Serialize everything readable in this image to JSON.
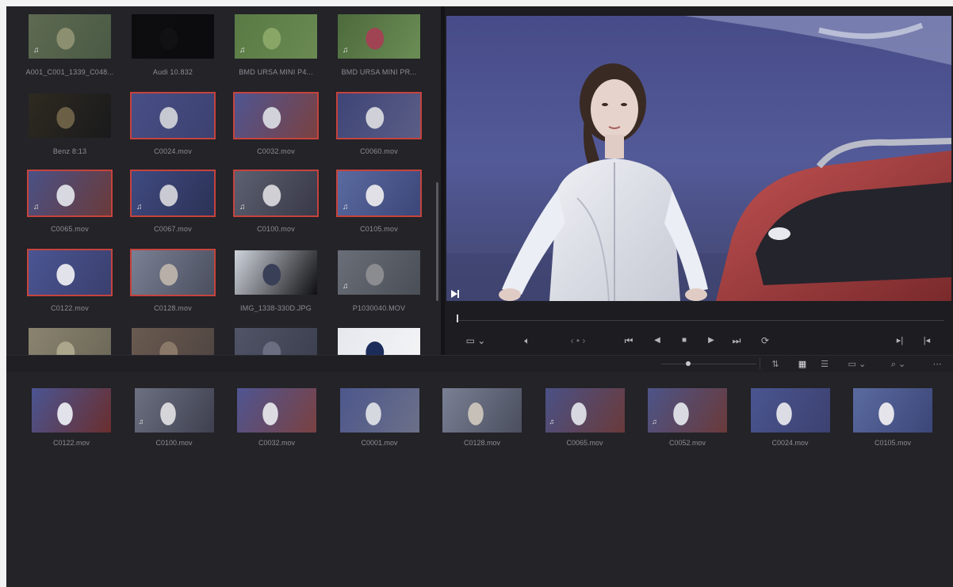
{
  "media_pool": {
    "clips": [
      {
        "label": "A001_C001_1339_C048...",
        "selected": false,
        "audio": true,
        "palette": [
          "#5e6a52",
          "#8c9070",
          "#4a5a44"
        ]
      },
      {
        "label": "Audi 10.832",
        "selected": false,
        "audio": false,
        "palette": [
          "#0d0d0f",
          "#111114",
          "#0c0c0e"
        ]
      },
      {
        "label": "BMD URSA MINI P4...",
        "selected": false,
        "audio": true,
        "palette": [
          "#5a7a45",
          "#89a667",
          "#6a8a52"
        ]
      },
      {
        "label": "BMD URSA MINI PR...",
        "selected": false,
        "audio": true,
        "palette": [
          "#4d6a3c",
          "#a04454",
          "#6b8d55"
        ]
      },
      {
        "label": "Benz 8:13",
        "selected": false,
        "audio": false,
        "palette": [
          "#2e2a20",
          "#6b6046",
          "#1a1a1c"
        ]
      },
      {
        "label": "C0024.mov",
        "selected": true,
        "audio": false,
        "palette": [
          "#484f86",
          "#c7c9d2",
          "#3c4170"
        ]
      },
      {
        "label": "C0032.mov",
        "selected": true,
        "audio": false,
        "palette": [
          "#4f5592",
          "#d2d3da",
          "#7a4141"
        ]
      },
      {
        "label": "C0060.mov",
        "selected": true,
        "audio": false,
        "palette": [
          "#3e4476",
          "#d0d1d8",
          "#5a5e86"
        ]
      },
      {
        "label": "C0065.mov",
        "selected": true,
        "audio": true,
        "palette": [
          "#4a5186",
          "#d8d9e0",
          "#6a3a3a"
        ]
      },
      {
        "label": "C0067.mov",
        "selected": true,
        "audio": true,
        "palette": [
          "#3f4a80",
          "#c9cad2",
          "#2c3256"
        ]
      },
      {
        "label": "C0100.mov",
        "selected": true,
        "audio": true,
        "palette": [
          "#5c6070",
          "#cfcfd4",
          "#383848"
        ]
      },
      {
        "label": "C0105.mov",
        "selected": true,
        "audio": true,
        "palette": [
          "#5a6aa0",
          "#e0e0e6",
          "#3c4678"
        ]
      },
      {
        "label": "C0122.mov",
        "selected": true,
        "audio": false,
        "palette": [
          "#4a5592",
          "#e2e3ea",
          "#3a3f6e"
        ]
      },
      {
        "label": "C0128.mov",
        "selected": true,
        "audio": false,
        "palette": [
          "#7a8094",
          "#b8b0a8",
          "#4a4e5e"
        ]
      },
      {
        "label": "IMG_1338-330D.JPG",
        "selected": false,
        "audio": false,
        "palette": [
          "#cfd4dc",
          "#3a3f58",
          "#0f0f12"
        ]
      },
      {
        "label": "P1030040.MOV",
        "selected": false,
        "audio": true,
        "palette": [
          "#6a6e78",
          "#8a8c90",
          "#4a4e56"
        ]
      },
      {
        "label": "",
        "selected": false,
        "audio": false,
        "palette": [
          "#8a8470",
          "#aca68c",
          "#6a6656"
        ]
      },
      {
        "label": "",
        "selected": false,
        "audio": false,
        "palette": [
          "#6a5a50",
          "#8a7868",
          "#4e4440"
        ]
      },
      {
        "label": "",
        "selected": false,
        "audio": false,
        "palette": [
          "#505466",
          "#6a6e80",
          "#3a3e4e"
        ]
      },
      {
        "label": "",
        "selected": false,
        "audio": false,
        "palette": [
          "#e6e8ee",
          "#1c2c5a",
          "#f4f4f6"
        ]
      }
    ]
  },
  "viewer": {
    "transport": {
      "viewer_mode": "▭ ⌄",
      "audio": "🔈︎",
      "jog": "‹ • ›",
      "first_frame": "⏮",
      "prev_frame": "◀",
      "stop": "■",
      "play": "▶",
      "last_frame": "⏭",
      "loop": "⟳",
      "mark_out": "▸|",
      "mark_in": "|◂"
    }
  },
  "strip_toolbar": {
    "sort": "⇅",
    "grid_view": "▦",
    "list_view": "☰",
    "clip_size": "▭ ⌄",
    "search": "⌕ ⌄",
    "more": "⋯"
  },
  "clip_strip": {
    "clips": [
      {
        "label": "C0122.mov",
        "audio": false,
        "palette": [
          "#4a5592",
          "#e2e3ea",
          "#6a2e2e"
        ]
      },
      {
        "label": "C0100.mov",
        "audio": true,
        "palette": [
          "#6c7080",
          "#d6d6da",
          "#3e4050"
        ]
      },
      {
        "label": "C0032.mov",
        "audio": false,
        "palette": [
          "#4f5592",
          "#dcdce2",
          "#7a4141"
        ]
      },
      {
        "label": "C0001.mov",
        "audio": false,
        "palette": [
          "#4c578c",
          "#d6d8e0",
          "#6c7088"
        ]
      },
      {
        "label": "C0128.mov",
        "audio": false,
        "palette": [
          "#7a8094",
          "#c6c0b8",
          "#4a4e5e"
        ]
      },
      {
        "label": "C0065.mov",
        "audio": true,
        "palette": [
          "#4a5186",
          "#d8d9e0",
          "#6a3a3a"
        ]
      },
      {
        "label": "C0052.mov",
        "audio": true,
        "palette": [
          "#4c5488",
          "#dadbe2",
          "#6a3a3a"
        ]
      },
      {
        "label": "C0024.mov",
        "audio": false,
        "palette": [
          "#4a5590",
          "#dcdde4",
          "#3c4170"
        ]
      },
      {
        "label": "C0105.mov",
        "audio": false,
        "palette": [
          "#5a6aa0",
          "#e4e4ea",
          "#3c4678"
        ]
      }
    ]
  }
}
